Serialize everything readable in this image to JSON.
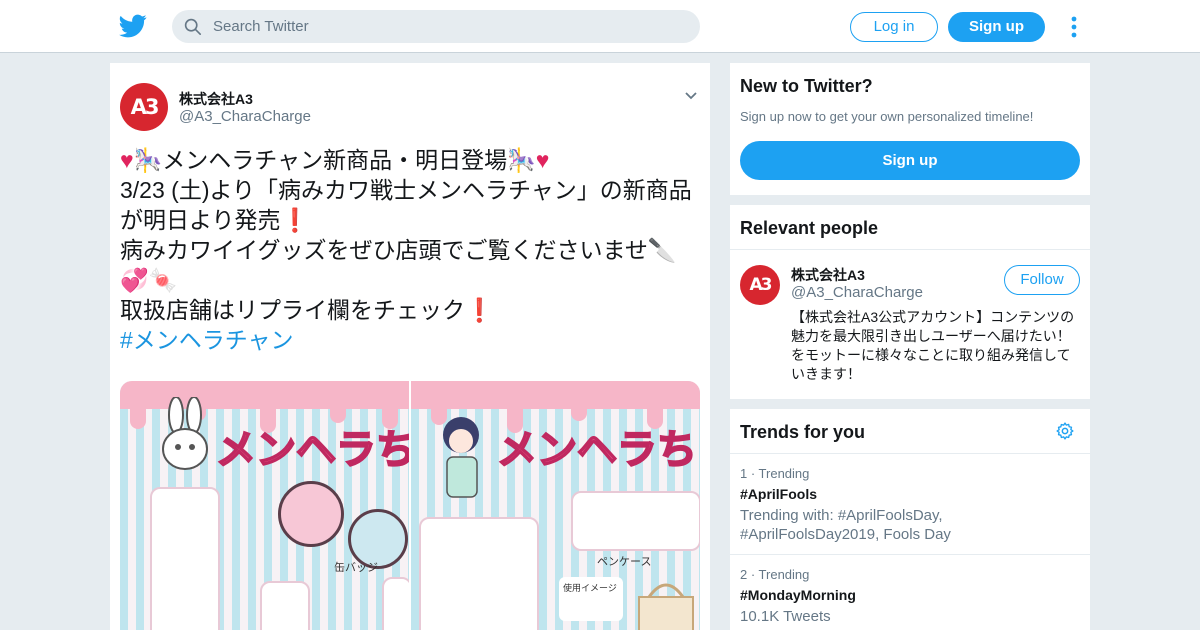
{
  "header": {
    "logo_icon": "twitter-bird-icon",
    "search_placeholder": "Search Twitter",
    "login_label": "Log in",
    "signup_label": "Sign up",
    "more_icon": "vertical-ellipsis-icon"
  },
  "tweet": {
    "author_name": "株式会社A3",
    "author_handle": "@A3_CharaCharge",
    "avatar_text": "A3",
    "line1": "メンヘラチャン新商品・明日登場",
    "line2": "3/23 (土)より「病みカワ戦士メンヘラチャン」の新商品が明日より発売",
    "line3": "病みカワイイグッズをぜひ店頭でご覧くださいませ",
    "line4": "取扱店舗はリプライ欄をチェック",
    "hashtag": "#メンヘラチャン",
    "media": {
      "panel1_title": "メンヘラち",
      "panel2_title": "メンヘラち",
      "panel1_caption": "缶バッジ",
      "panel2_caption": "ペンケース",
      "panel2_note": "使用イメージ"
    }
  },
  "new_to_twitter": {
    "title": "New to Twitter?",
    "subtitle": "Sign up now to get your own personalized timeline!",
    "button": "Sign up"
  },
  "relevant_people": {
    "title": "Relevant people",
    "person": {
      "name": "株式会社A3",
      "handle": "@A3_CharaCharge",
      "avatar_text": "A3",
      "follow_label": "Follow",
      "bio": "【株式会社A3公式アカウント】コンテンツの魅力を最大限引き出しユーザーへ届けたい！をモットーに様々なことに取り組み発信していきます！"
    }
  },
  "trends": {
    "title": "Trends for you",
    "settings_icon": "gear-icon",
    "items": [
      {
        "meta": "1 · Trending",
        "name": "#AprilFools",
        "desc": "Trending with: #AprilFoolsDay, #AprilFoolsDay2019, Fools Day"
      },
      {
        "meta": "2 · Trending",
        "name": "#MondayMorning",
        "desc": "10.1K Tweets"
      }
    ]
  },
  "colors": {
    "brand_blue": "#1da1f2",
    "background": "#e6ecf0",
    "avatar_red": "#d7262f",
    "hashtag_blue": "#1b95e0"
  }
}
